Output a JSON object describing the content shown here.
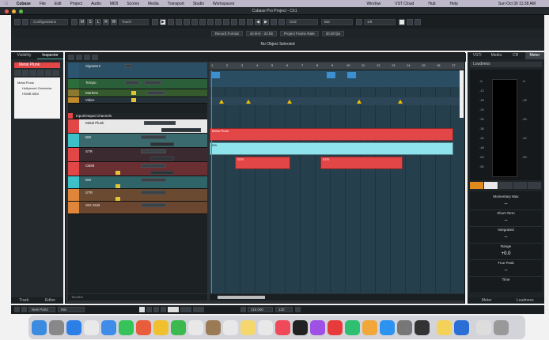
{
  "menubar": {
    "app": "Cubase",
    "items": [
      "File",
      "Edit",
      "Project",
      "Audio",
      "MIDI",
      "Scores",
      "Media",
      "Transport",
      "Studio",
      "Workspaces",
      "Window",
      "VST Cloud",
      "Hub",
      "Help"
    ],
    "clock": "Sun Oct 30  11:38 AM"
  },
  "window": {
    "title": "Cubase Pro Project - Ch1"
  },
  "toolbar": {
    "configurations": "Configurations",
    "touch": "Touch",
    "grid": "Grid",
    "bar": "Bar",
    "quantize": "1/8"
  },
  "status": {
    "record_format": "Record Format",
    "sample_rate": "44 kHz - 24 bit",
    "frame_rate": "Project Frame Rate",
    "fps": "30.00 fps"
  },
  "infoline": "No Object Selected",
  "leftzone": {
    "tabs": [
      "Visibility",
      "Inspector"
    ],
    "track": "Metal Plunk",
    "items": [
      "Metal Plunk",
      "Hollywood Orchestra",
      "HSMB MIDI"
    ],
    "bottom_tabs": [
      "Track",
      "Editor"
    ]
  },
  "tracks": [
    {
      "name": "Signature",
      "color": "#2b5570"
    },
    {
      "name": "Tempo",
      "color": "#2c6e3b"
    },
    {
      "name": "Markers",
      "color": "#c9b64a"
    },
    {
      "name": "Video",
      "color": "#1f2427"
    },
    {
      "name": "Input/Output Channels",
      "color": "#1f2427"
    },
    {
      "name": "Metal Plunk",
      "color": "#e34646"
    },
    {
      "name": "BW",
      "color": "#3ec0c8"
    },
    {
      "name": "STR",
      "color": "#e34646"
    },
    {
      "name": "CB88",
      "color": "#e34646"
    },
    {
      "name": "BW",
      "color": "#3ec0c8"
    },
    {
      "name": "STR",
      "color": "#e0863a"
    },
    {
      "name": "SIG SUB",
      "color": "#e0863a"
    }
  ],
  "ruler": [
    "1",
    "2",
    "3",
    "4",
    "5",
    "6",
    "7",
    "8",
    "9",
    "10",
    "11",
    "12",
    "13",
    "14",
    "15",
    "16",
    "17"
  ],
  "events": {
    "metal": "Metal Plunk",
    "bw": "BW",
    "str1": "STR",
    "str2": "STR"
  },
  "project_footer": "Timeline",
  "rightzone": {
    "tabs": [
      "VSTi",
      "Media",
      "CR",
      "Meter"
    ],
    "loudness": "Loudness",
    "scale": [
      "-6",
      "-12",
      "-18",
      "-24",
      "-30",
      "-36",
      "-42",
      "-48",
      "-54",
      "-60"
    ],
    "stats": [
      {
        "label": "Momentary Max",
        "value": "--"
      },
      {
        "label": "Short-Term",
        "value": "--"
      },
      {
        "label": "Integrated",
        "value": "--"
      },
      {
        "label": "Range",
        "value": "+0.0"
      },
      {
        "label": "True Peak",
        "value": "--"
      },
      {
        "label": "Time",
        "value": ""
      }
    ],
    "bottom_tabs": [
      "Meter",
      "Loudness"
    ]
  },
  "transport": {
    "mode": "New Parts",
    "mix": "Mix",
    "position": "115.000",
    "tempo": "120"
  },
  "dock_colors": [
    "#3b8be0",
    "#888",
    "#2d7fe8",
    "#e9e9e9",
    "#3f8de8",
    "#35c35a",
    "#e95d3c",
    "#f0c02e",
    "#3bb84e",
    "#e8e8e8",
    "#f5a623",
    "#9b7b55",
    "#f5d76e",
    "#e8e8e8",
    "#2a8be0",
    "#f04a5a",
    "#222",
    "#9f50e5",
    "#e83b3b",
    "#2fbf71",
    "#f2a73b",
    "#2c93f0",
    "#777",
    "#333",
    "#f4d25a",
    "#2b6fd6",
    "#ddd",
    "#999"
  ]
}
